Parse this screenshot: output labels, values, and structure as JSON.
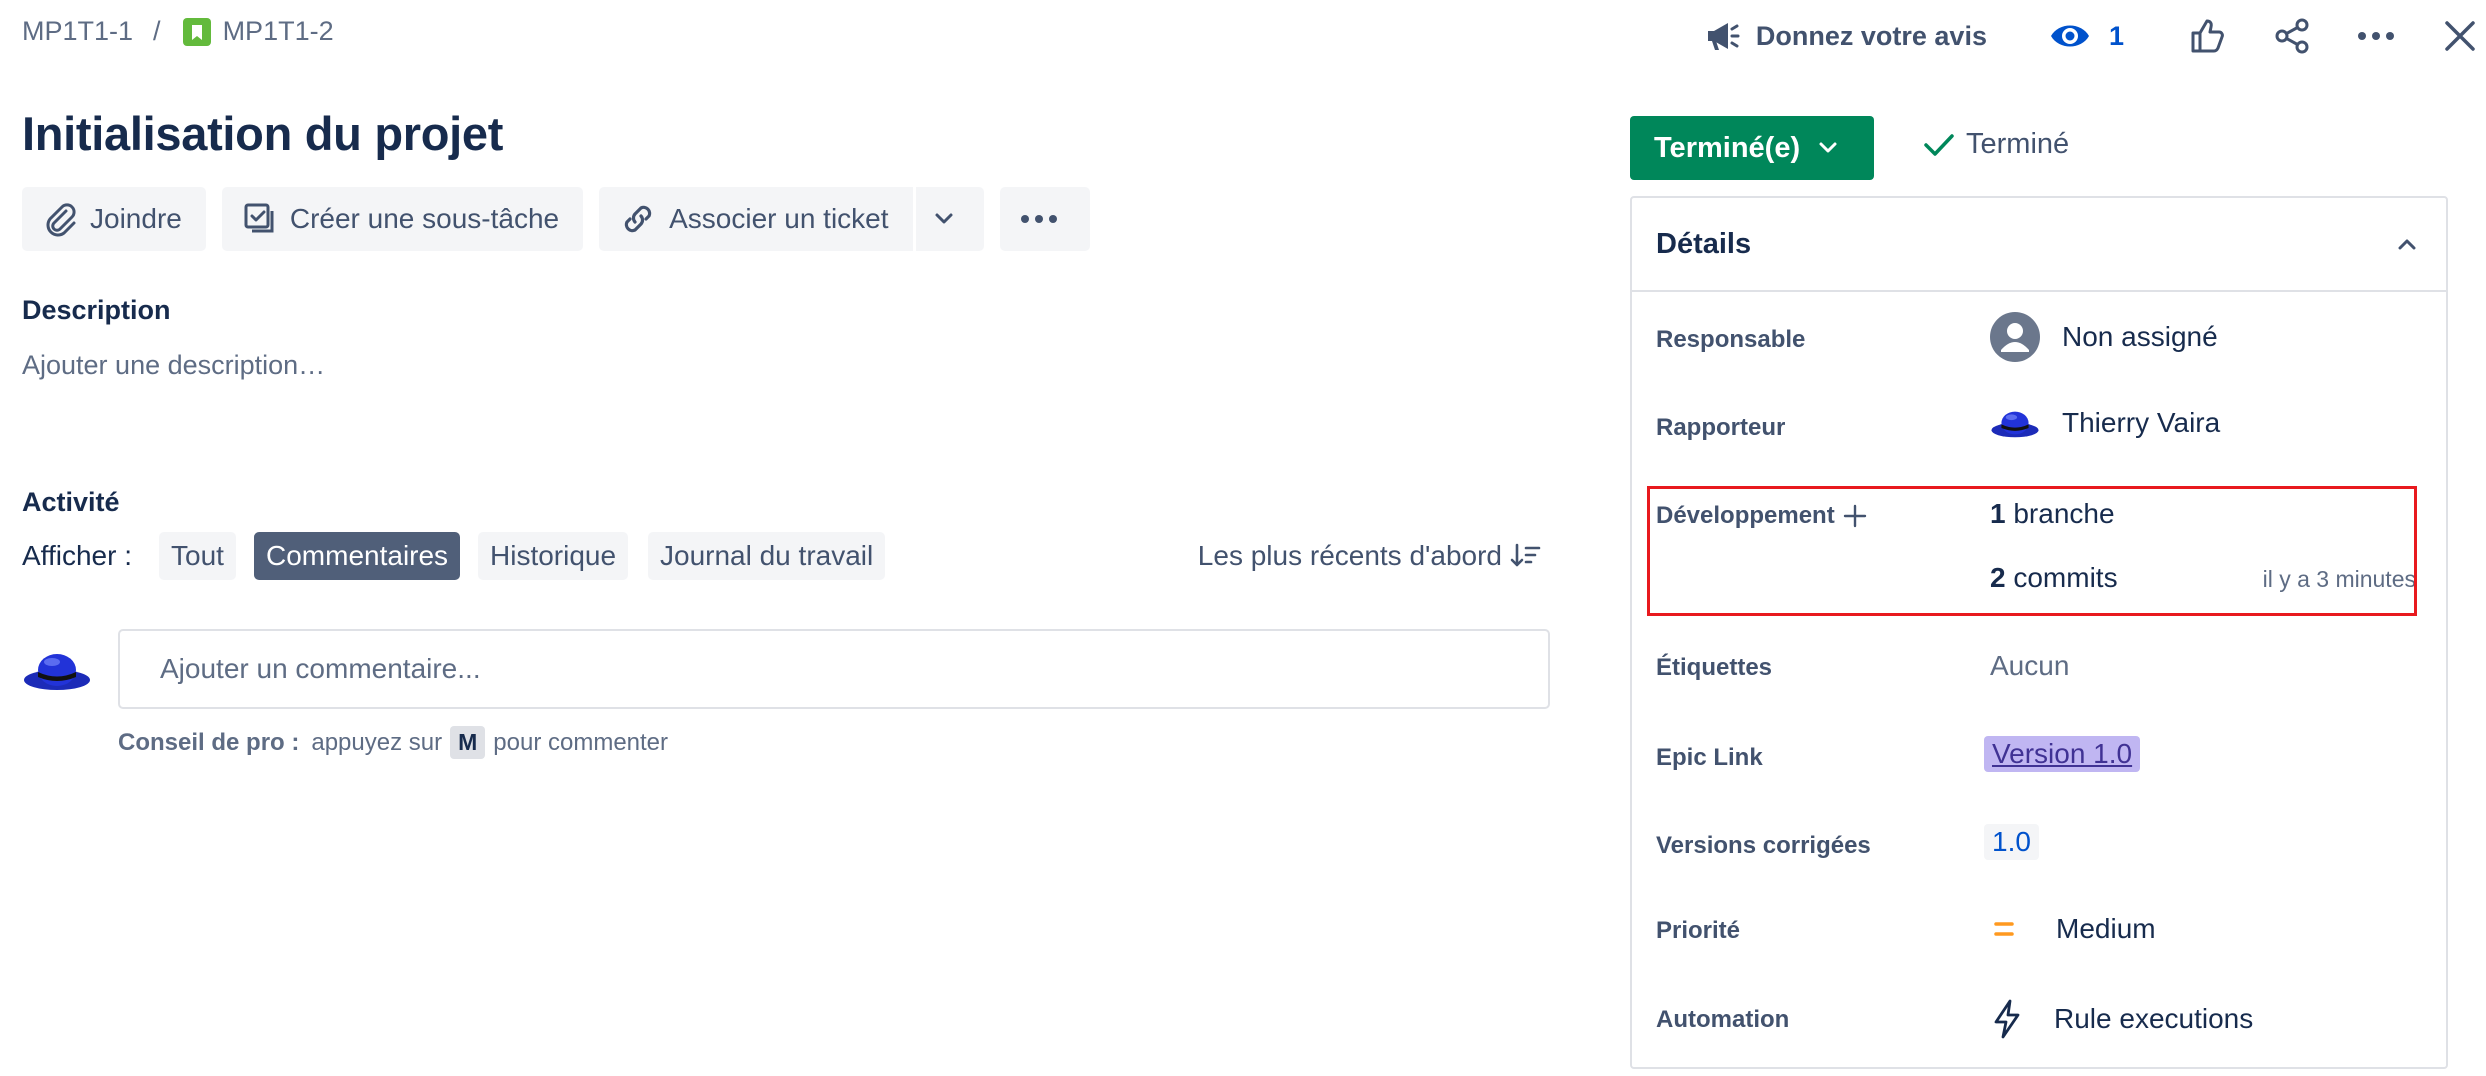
{
  "breadcrumb": {
    "parent": "MP1T1-1",
    "separator": "/",
    "current": "MP1T1-2"
  },
  "top_actions": {
    "feedback_label": "Donnez votre avis",
    "watchers_count": "1",
    "icons": [
      "megaphone-icon",
      "eye-icon",
      "thumbs-up-icon",
      "share-icon",
      "more-icon",
      "close-icon"
    ]
  },
  "issue": {
    "title": "Initialisation du projet"
  },
  "toolbar": {
    "attach_label": "Joindre",
    "subtask_label": "Créer une sous-tâche",
    "link_label": "Associer un ticket"
  },
  "description": {
    "heading": "Description",
    "placeholder": "Ajouter une description…"
  },
  "activity": {
    "heading": "Activité",
    "show_label": "Afficher :",
    "filters": [
      {
        "label": "Tout",
        "active": false
      },
      {
        "label": "Commentaires",
        "active": true
      },
      {
        "label": "Historique",
        "active": false
      },
      {
        "label": "Journal du travail",
        "active": false
      }
    ],
    "sort_label": "Les plus récents d'abord",
    "comment_placeholder": "Ajouter un commentaire...",
    "protip_label": "Conseil de pro :",
    "protip_before": "appuyez sur",
    "protip_key": "M",
    "protip_after": "pour commenter"
  },
  "status": {
    "button_label": "Terminé(e)",
    "resolution": "Terminé",
    "color": "#00875a"
  },
  "details": {
    "heading": "Détails",
    "assignee": {
      "label": "Responsable",
      "value": "Non assigné"
    },
    "reporter": {
      "label": "Rapporteur",
      "value": "Thierry Vaira"
    },
    "development": {
      "label": "Développement",
      "branch_count": "1",
      "branch_word": "branche",
      "commit_count": "2",
      "commit_word": "commits",
      "updated": "il y a 3 minutes"
    },
    "labels": {
      "label": "Étiquettes",
      "value": "Aucun"
    },
    "epic_link": {
      "label": "Epic Link",
      "value": "Version 1.0"
    },
    "fix_versions": {
      "label": "Versions corrigées",
      "value": "1.0"
    },
    "priority": {
      "label": "Priorité",
      "value": "Medium",
      "color": "#ff991f"
    },
    "automation": {
      "label": "Automation",
      "value": "Rule executions"
    }
  }
}
